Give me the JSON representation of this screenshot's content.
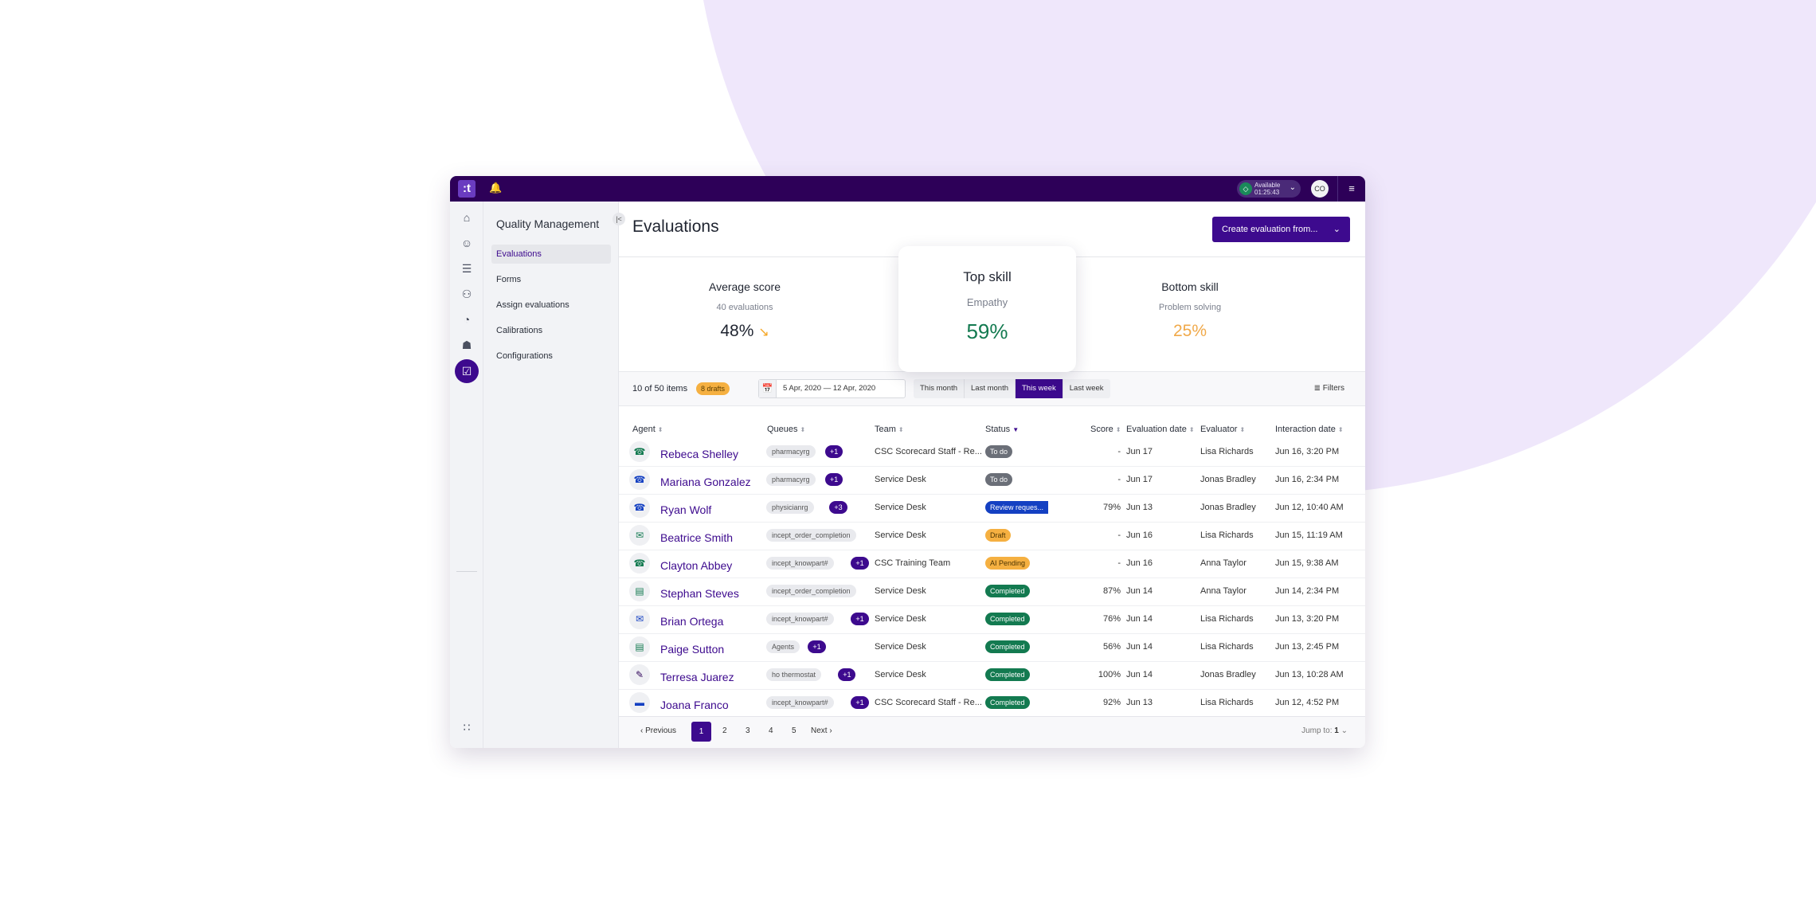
{
  "topbar": {
    "logo": ":t",
    "status_label": "Available",
    "status_timer": "01:25:43",
    "avatar_initials": "CO"
  },
  "sidebar": {
    "title": "Quality Management",
    "items": [
      {
        "label": "Evaluations",
        "active": true
      },
      {
        "label": "Forms"
      },
      {
        "label": "Assign evaluations"
      },
      {
        "label": "Calibrations"
      },
      {
        "label": "Configurations"
      }
    ]
  },
  "header": {
    "title": "Evaluations",
    "create_button": "Create evaluation from..."
  },
  "stats": {
    "average": {
      "title": "Average score",
      "sub": "40 evaluations",
      "value": "48%",
      "trend": "down"
    },
    "top": {
      "title": "Top skill",
      "sub": "Empathy",
      "value": "59%"
    },
    "bottom": {
      "title": "Bottom skill",
      "sub": "Problem solving",
      "value": "25%"
    }
  },
  "toolbar": {
    "items_count": "10 of 50 items",
    "drafts": "8 drafts",
    "date_range": "5 Apr, 2020 — 12 Apr, 2020",
    "ranges": [
      "This month",
      "Last month",
      "This week",
      "Last week"
    ],
    "active_range": "This week",
    "filters_label": "Filters"
  },
  "table": {
    "columns": [
      "Agent",
      "Queues",
      "Team",
      "Status",
      "Score",
      "Evaluation date",
      "Evaluator",
      "Interaction date"
    ],
    "sorted_column": "Status",
    "rows": [
      {
        "channel": "phone-inbound",
        "agent": "Rebeca Shelley",
        "queue": "pharmacyrg",
        "more": "+1",
        "team": "CSC Scorecard Staff - Re...",
        "status": "To do",
        "score": "-",
        "eval_date": "Jun 17",
        "evaluator": "Lisa Richards",
        "interaction_date": "Jun 16, 3:20 PM"
      },
      {
        "channel": "phone-outbound",
        "agent": "Mariana Gonzalez",
        "queue": "pharmacyrg",
        "more": "+1",
        "team": "Service Desk",
        "status": "To do",
        "score": "-",
        "eval_date": "Jun 17",
        "evaluator": "Jonas Bradley",
        "interaction_date": "Jun 16, 2:34 PM"
      },
      {
        "channel": "phone-outbound",
        "agent": "Ryan Wolf",
        "queue": "physicianrg",
        "more": "+3",
        "team": "Service Desk",
        "status": "Review reques...",
        "score": "79%",
        "eval_date": "Jun 13",
        "evaluator": "Jonas Bradley",
        "interaction_date": "Jun 12, 10:40 AM"
      },
      {
        "channel": "chat",
        "agent": "Beatrice Smith",
        "queue": "incept_order_completion",
        "more": "",
        "team": "Service Desk",
        "status": "Draft",
        "score": "-",
        "eval_date": "Jun 16",
        "evaluator": "Lisa Richards",
        "interaction_date": "Jun 15, 11:19 AM"
      },
      {
        "channel": "phone-inbound",
        "agent": "Clayton Abbey",
        "queue": "incept_knowpart#",
        "more": "+1",
        "team": "CSC Training Team",
        "status": "AI Pending",
        "score": "-",
        "eval_date": "Jun 16",
        "evaluator": "Anna Taylor",
        "interaction_date": "Jun 15, 9:38 AM"
      },
      {
        "channel": "messaging",
        "agent": "Stephan Steves",
        "queue": "incept_order_completion",
        "more": "",
        "team": "Service Desk",
        "status": "Completed",
        "score": "87%",
        "eval_date": "Jun 14",
        "evaluator": "Anna Taylor",
        "interaction_date": "Jun 14, 2:34 PM"
      },
      {
        "channel": "email",
        "agent": "Brian Ortega",
        "queue": "incept_knowpart#",
        "more": "+1",
        "team": "Service Desk",
        "status": "Completed",
        "score": "76%",
        "eval_date": "Jun 14",
        "evaluator": "Lisa Richards",
        "interaction_date": "Jun 13, 3:20 PM"
      },
      {
        "channel": "messaging",
        "agent": "Paige Sutton",
        "queue": "Agents",
        "more": "+1",
        "team": "Service Desk",
        "status": "Completed",
        "score": "56%",
        "eval_date": "Jun 14",
        "evaluator": "Lisa Richards",
        "interaction_date": "Jun 13, 2:45 PM"
      },
      {
        "channel": "task",
        "agent": "Terresa Juarez",
        "queue": "ho thermostat",
        "more": "+1",
        "team": "Service Desk",
        "status": "Completed",
        "score": "100%",
        "eval_date": "Jun 14",
        "evaluator": "Jonas Bradley",
        "interaction_date": "Jun 13, 10:28 AM"
      },
      {
        "channel": "sms",
        "agent": "Joana Franco",
        "queue": "incept_knowpart#",
        "more": "+1",
        "team": "CSC Scorecard Staff - Re...",
        "status": "Completed",
        "score": "92%",
        "eval_date": "Jun 13",
        "evaluator": "Lisa Richards",
        "interaction_date": "Jun 12, 4:52 PM"
      }
    ]
  },
  "pagination": {
    "previous": "Previous",
    "pages": [
      "1",
      "2",
      "3",
      "4",
      "5"
    ],
    "current": "1",
    "next": "Next",
    "jump_label": "Jump to:",
    "jump_value": "1"
  },
  "colors": {
    "brand": "#3d0a8e",
    "topbar": "#2d0058",
    "success": "#137a50",
    "warning": "#f5b041",
    "todo": "#6b6f78",
    "review": "#1440c2"
  }
}
